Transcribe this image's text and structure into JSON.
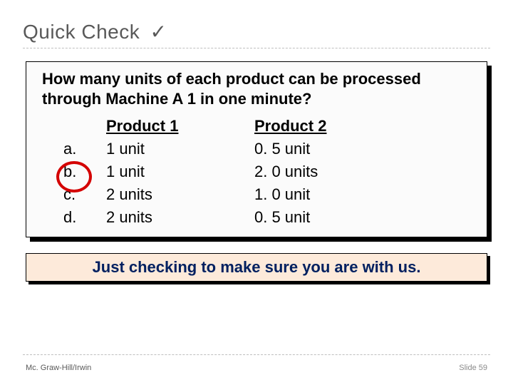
{
  "title": "Quick Check",
  "check_glyph": "✓",
  "question": "How many units of each product can be processed through Machine A 1 in one minute?",
  "headers": {
    "p1": "Product 1",
    "p2": "Product 2"
  },
  "options": [
    {
      "key": "a.",
      "p1": "1 unit",
      "p2": "0. 5 unit"
    },
    {
      "key": "b.",
      "p1": "1 unit",
      "p2": "2. 0 units"
    },
    {
      "key": "c.",
      "p1": "2 units",
      "p2": "1. 0 unit"
    },
    {
      "key": "d.",
      "p1": "2 units",
      "p2": "0. 5 unit"
    }
  ],
  "circled_index": 1,
  "banner": "Just checking to make sure you are with us.",
  "footer_left": "Mc. Graw-Hill/Irwin",
  "footer_right": "Slide 59"
}
